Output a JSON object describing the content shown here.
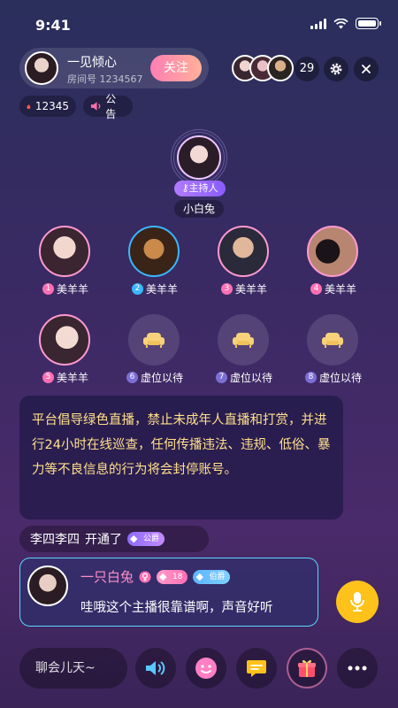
{
  "status": {
    "time": "9:41"
  },
  "host": {
    "name": "一见倾心",
    "room_label": "房间号 1234567",
    "follow_label": "关注"
  },
  "viewers": {
    "count": "29"
  },
  "stats": {
    "heat": "12345",
    "notice_label": "公告"
  },
  "host_seat": {
    "badge": "主持人",
    "name": "小白兔"
  },
  "seats": [
    {
      "num": "1",
      "name": "美羊羊",
      "num_color": "#ff6fb4"
    },
    {
      "num": "2",
      "name": "美羊羊",
      "num_color": "#3ab7ff"
    },
    {
      "num": "3",
      "name": "美羊羊",
      "num_color": "#ff6fb4"
    },
    {
      "num": "4",
      "name": "美羊羊",
      "num_color": "#ff6fb4"
    },
    {
      "num": "5",
      "name": "美羊羊",
      "num_color": "#ff6fb4"
    },
    {
      "num": "6",
      "name": "虚位以待",
      "num_color": "#7b6fd6"
    },
    {
      "num": "7",
      "name": "虚位以待",
      "num_color": "#7b6fd6"
    },
    {
      "num": "8",
      "name": "虚位以待",
      "num_color": "#7b6fd6"
    }
  ],
  "notice": {
    "text": "平台倡导绿色直播，禁止未成年人直播和打赏，并进行24小时在线巡查，任何传播违法、违规、低俗、暴力等不良信息的行为将会封停账号。"
  },
  "enter_message": {
    "user": "李四李四",
    "action": "开通了",
    "noble": "公爵"
  },
  "chat": {
    "name": "一只白兔",
    "level": "18",
    "noble": "伯爵",
    "text": "哇哦这个主播很靠谱啊，声音好听"
  },
  "bottom": {
    "input_placeholder": "聊会儿天~"
  },
  "colors": {
    "accent_yellow": "#ffc21a",
    "chat_border": "#5bd4ff",
    "name_pink": "#ff8fc7",
    "notice_text": "#ffe08a"
  }
}
